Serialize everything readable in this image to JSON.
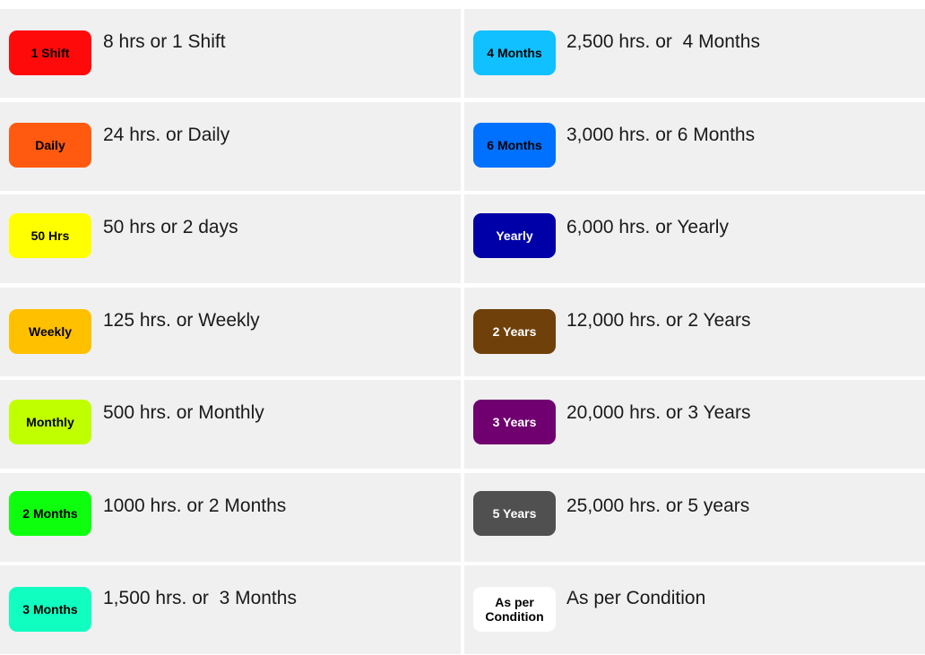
{
  "left_column": [
    {
      "badge": "1 Shift",
      "badge_color": "#ff0a0a",
      "badge_text_color": "#000000",
      "description": "8 hrs or 1 Shift"
    },
    {
      "badge": "Daily",
      "badge_color": "#ff5a0f",
      "badge_text_color": "#000000",
      "description": "24 hrs. or Daily"
    },
    {
      "badge": "50 Hrs",
      "badge_color": "#ffff00",
      "badge_text_color": "#000000",
      "description": "50 hrs or 2 days"
    },
    {
      "badge": "Weekly",
      "badge_color": "#ffc000",
      "badge_text_color": "#000000",
      "description": "125 hrs. or Weekly"
    },
    {
      "badge": "Monthly",
      "badge_color": "#c0ff00",
      "badge_text_color": "#000000",
      "description": "500 hrs. or Monthly"
    },
    {
      "badge": "2 Months",
      "badge_color": "#0eff0e",
      "badge_text_color": "#000000",
      "description": "1000 hrs. or 2 Months"
    },
    {
      "badge": "3 Months",
      "badge_color": "#10ffc0",
      "badge_text_color": "#000000",
      "description": "1,500 hrs. or  3 Months"
    }
  ],
  "right_column": [
    {
      "badge": "4 Months",
      "badge_color": "#10c0ff",
      "badge_text_color": "#000000",
      "description": "2,500 hrs. or  4 Months"
    },
    {
      "badge": "6 Months",
      "badge_color": "#0070ff",
      "badge_text_color": "#000000",
      "description": "3,000 hrs. or 6 Months"
    },
    {
      "badge": "Yearly",
      "badge_color": "#0000a8",
      "badge_text_color": "#ffffff",
      "description": "6,000 hrs. or Yearly"
    },
    {
      "badge": "2 Years",
      "badge_color": "#70400a",
      "badge_text_color": "#ffffff",
      "description": "12,000 hrs. or 2 Years"
    },
    {
      "badge": "3 Years",
      "badge_color": "#700070",
      "badge_text_color": "#ffffff",
      "description": "20,000 hrs. or 3 Years"
    },
    {
      "badge": "5 Years",
      "badge_color": "#505050",
      "badge_text_color": "#ffffff",
      "description": "25,000 hrs. or 5 years"
    },
    {
      "badge": "As per Condition",
      "badge_color": "#ffffff",
      "badge_text_color": "#000000",
      "description": "As per Condition"
    }
  ]
}
